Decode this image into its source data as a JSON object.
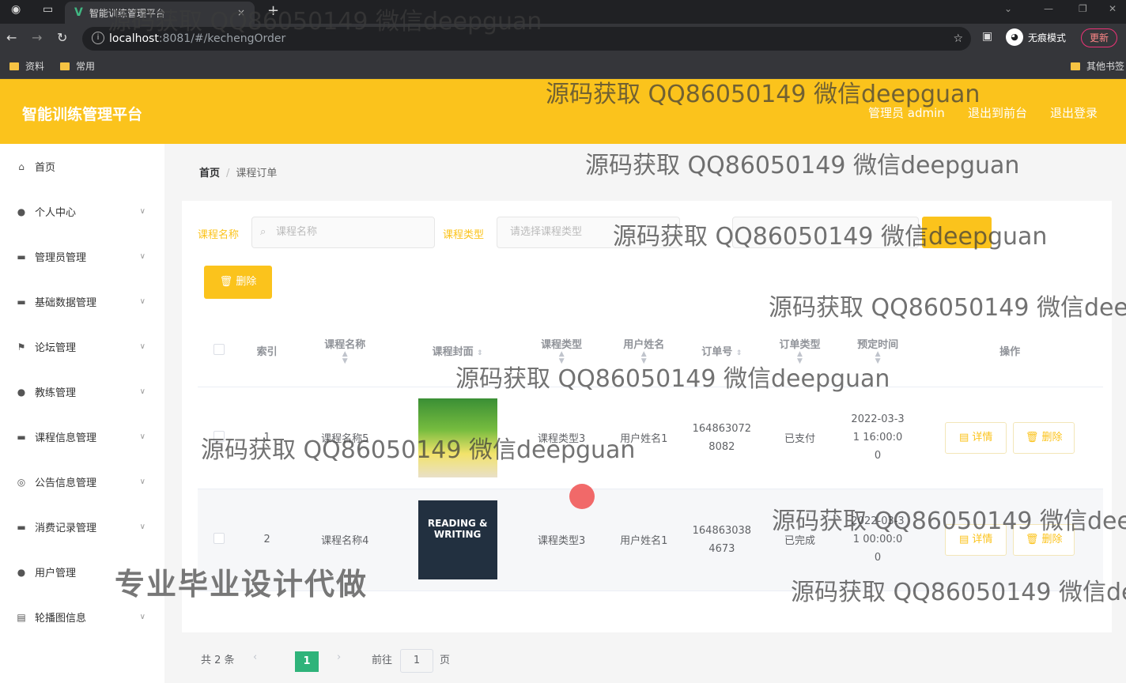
{
  "browser": {
    "tab_title": "智能训练管理平台",
    "tab_close": "×",
    "new_tab": "+",
    "url_host": "localhost",
    "url_path": ":8081/#/kechengOrder",
    "incognito_label": "无痕模式",
    "update_label": "更新",
    "bookmarks": [
      "资料",
      "常用"
    ],
    "other_bookmarks": "其他书签"
  },
  "header": {
    "title": "智能训练管理平台",
    "user_label": "管理员 admin",
    "front_link": "退出到前台",
    "logout_link": "退出登录"
  },
  "sidebar": {
    "items": [
      {
        "label": "首页",
        "icon": "home-icon",
        "has_children": false
      },
      {
        "label": "个人中心",
        "icon": "user-icon",
        "has_children": true
      },
      {
        "label": "管理员管理",
        "icon": "admin-icon",
        "has_children": true
      },
      {
        "label": "基础数据管理",
        "icon": "data-icon",
        "has_children": true
      },
      {
        "label": "论坛管理",
        "icon": "flag-icon",
        "has_children": true
      },
      {
        "label": "教练管理",
        "icon": "coach-icon",
        "has_children": true
      },
      {
        "label": "课程信息管理",
        "icon": "course-icon",
        "has_children": true
      },
      {
        "label": "公告信息管理",
        "icon": "notice-icon",
        "has_children": true
      },
      {
        "label": "消费记录管理",
        "icon": "record-icon",
        "has_children": true
      },
      {
        "label": "用户管理",
        "icon": "users-icon",
        "has_children": false
      },
      {
        "label": "轮播图信息",
        "icon": "carousel-icon",
        "has_children": true
      }
    ]
  },
  "breadcrumb": {
    "home": "首页",
    "current": "课程订单"
  },
  "filters": {
    "course_name_label": "课程名称",
    "course_name_placeholder": "课程名称",
    "course_type_label": "课程类型",
    "course_type_placeholder": "请选择课程类型"
  },
  "actions": {
    "delete_label": "删除"
  },
  "table": {
    "headers": {
      "index": "索引",
      "course_name": "课程名称",
      "cover": "课程封面",
      "course_type": "课程类型",
      "user_name": "用户姓名",
      "order_no": "订单号",
      "order_type": "订单类型",
      "booking_time": "预定时间",
      "actions": "操作"
    },
    "rows": [
      {
        "index": "1",
        "course_name": "课程名称5",
        "course_type": "课程类型3",
        "user_name": "用户姓名1",
        "order_no": "1648630728082",
        "order_type": "已支付",
        "booking_time": "2022-03-31 16:00:00"
      },
      {
        "index": "2",
        "course_name": "课程名称4",
        "course_type": "课程类型3",
        "user_name": "用户姓名1",
        "order_no": "1648630384673",
        "order_type": "已完成",
        "booking_time": "2022-03-31 00:00:00"
      }
    ],
    "detail_label": "详情",
    "row_delete_label": "删除",
    "cover2_text": "READING & WRITING"
  },
  "pagination": {
    "total": "共 2 条",
    "prev": "‹",
    "current_page": "1",
    "next": "›",
    "goto_prefix": "前往",
    "goto_value": "1",
    "goto_suffix": "页"
  },
  "overlays": {
    "watermark": "源码获取 QQ86050149 微信deepguan",
    "ad_text": "专业毕业设计代做"
  },
  "colors": {
    "accent": "#fbc31c",
    "page_active": "#2fb37a"
  }
}
